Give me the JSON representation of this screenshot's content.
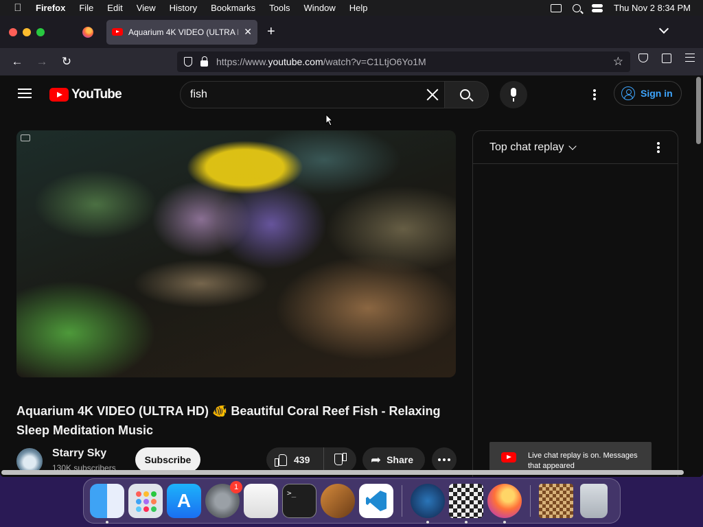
{
  "menubar": {
    "app": "Firefox",
    "items": [
      "File",
      "Edit",
      "View",
      "History",
      "Bookmarks",
      "Tools",
      "Window",
      "Help"
    ],
    "datetime": "Thu Nov 2  8:34 PM"
  },
  "browser": {
    "tab_title": "Aquarium 4K VIDEO (ULTRA HD",
    "url_prefix": "https://www.",
    "url_host": "youtube.com",
    "url_path": "/watch?v=C1LtjO6Yo1M"
  },
  "youtube": {
    "logo_text": "YouTube",
    "search_value": "fish",
    "sign_in": "Sign in",
    "video_title": "Aquarium 4K VIDEO (ULTRA HD) 🐠 Beautiful Coral Reef Fish - Relaxing Sleep Meditation Music",
    "channel_name": "Starry Sky",
    "subscribers": "130K subscribers",
    "subscribe_label": "Subscribe",
    "likes": "439",
    "share_label": "Share",
    "chat_title": "Top chat replay",
    "chat_notice": "Live chat replay is on. Messages that appeared"
  },
  "dock": {
    "items": [
      "Finder",
      "Launchpad",
      "App Store",
      "System Settings",
      "TextEdit",
      "Terminal",
      "GarageBand",
      "Visual Studio Code",
      "Steam",
      "Chess",
      "Firefox",
      "Chess Board",
      "Trash"
    ],
    "settings_badge": "1"
  }
}
